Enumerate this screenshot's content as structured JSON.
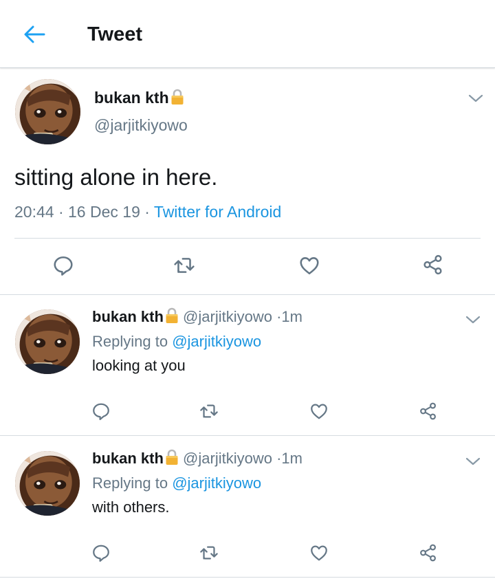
{
  "header": {
    "title": "Tweet",
    "accent": "#1da1f2"
  },
  "main_tweet": {
    "display_name": "bukan kth",
    "handle": "@jarjitkiyowo",
    "text": "sitting alone in here.",
    "time": "20:44",
    "sep1": "·",
    "date": "16 Dec 19",
    "sep2": "·",
    "source": "Twitter for Android",
    "actions": [
      "reply-icon",
      "retweet-icon",
      "like-icon",
      "share-icon"
    ]
  },
  "replies": [
    {
      "display_name": "bukan kth",
      "handle": "@jarjitkiyowo",
      "dot": "·",
      "age": "1m",
      "replying_prefix": "Replying to",
      "replying_to": "@jarjitkiyowo",
      "text": "looking at you"
    },
    {
      "display_name": "bukan kth",
      "handle": "@jarjitkiyowo",
      "dot": "·",
      "age": "1m",
      "replying_prefix": "Replying to",
      "replying_to": "@jarjitkiyowo",
      "text": "with others."
    }
  ],
  "colors": {
    "link": "#1b95e0",
    "muted": "#657786",
    "icon": "#657786"
  }
}
